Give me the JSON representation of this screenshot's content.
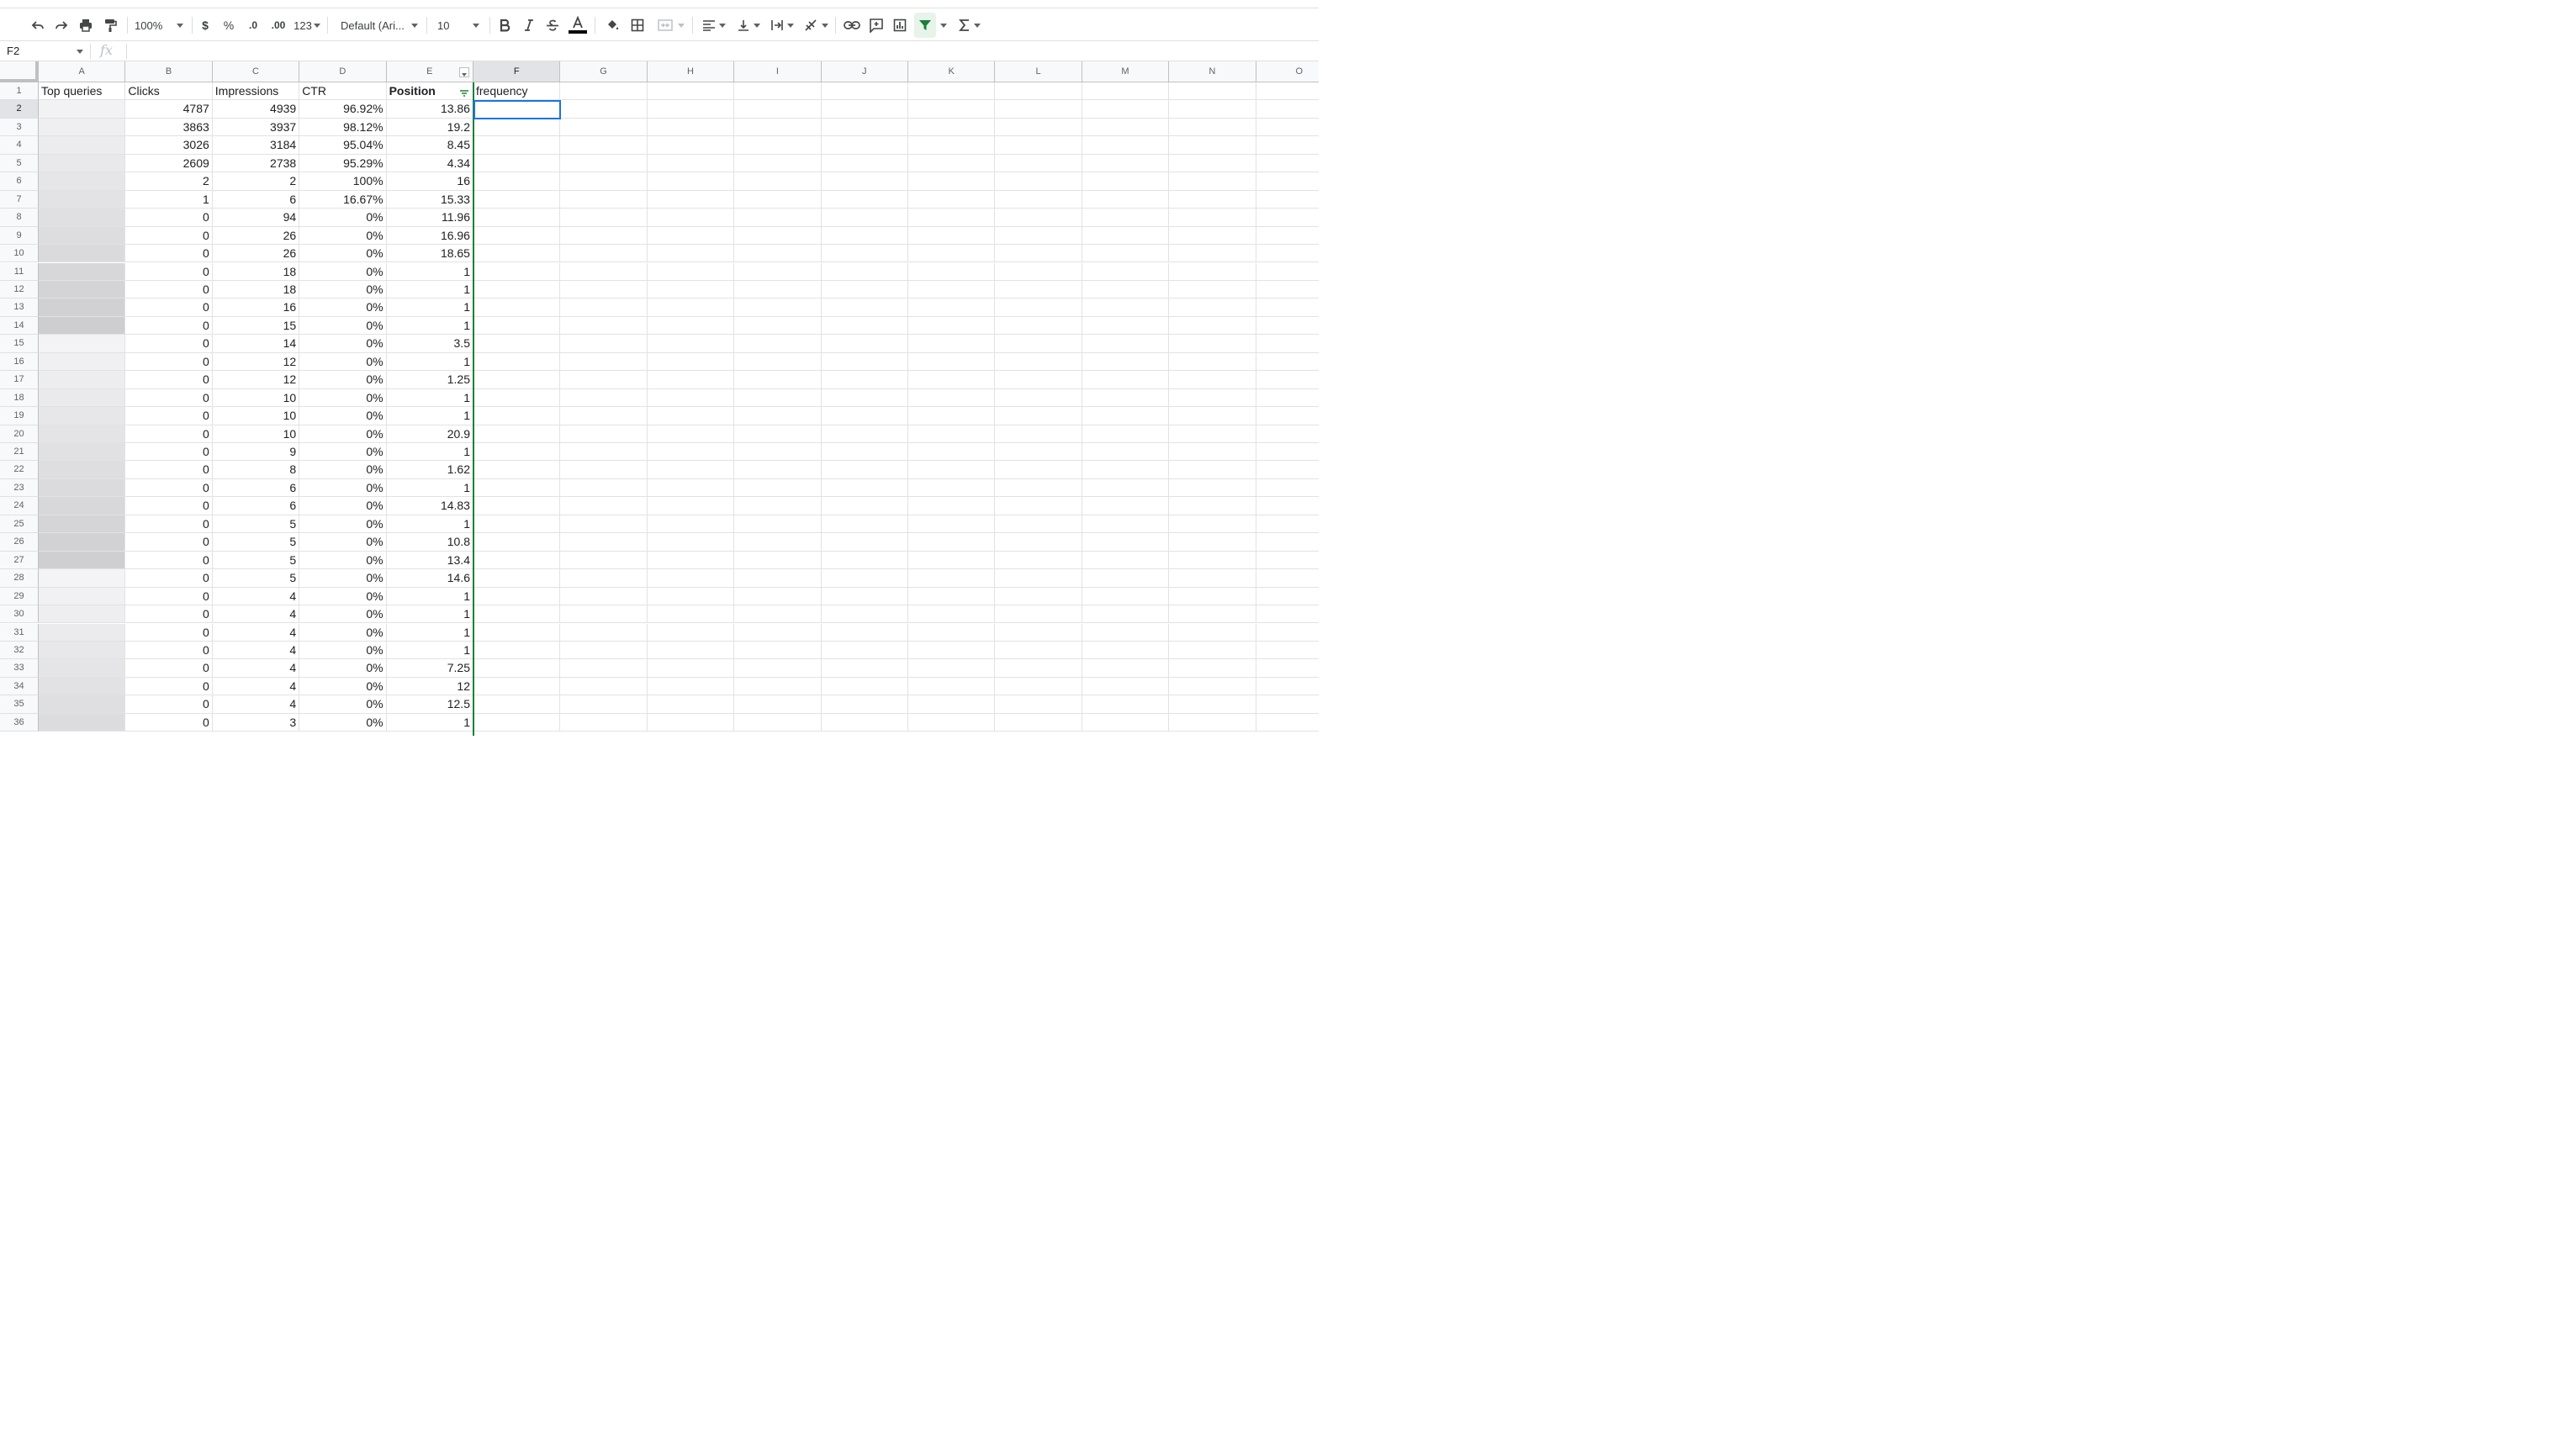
{
  "toolbar": {
    "zoom": "100%",
    "currency": "$",
    "percent": "%",
    "dec_less": ".0",
    "dec_more": ".00",
    "more_formats": "123",
    "font": "Default (Ari...",
    "font_size": "10",
    "icons": [
      "undo-icon",
      "redo-icon",
      "print-icon",
      "paint-format-icon",
      "bold-icon",
      "italic-icon",
      "strikethrough-icon",
      "text-color-icon",
      "fill-color-icon",
      "borders-icon",
      "merge-icon",
      "align-icon",
      "valign-icon",
      "wrap-icon",
      "rotate-icon",
      "link-icon",
      "comment-icon",
      "chart-icon",
      "filter-icon",
      "functions-icon"
    ],
    "accent_filter": "#188038"
  },
  "formula_bar": {
    "name_box": "F2",
    "fx": "fx",
    "content": ""
  },
  "columns": [
    "A",
    "B",
    "C",
    "D",
    "E",
    "F",
    "G",
    "H",
    "I",
    "J",
    "K",
    "L",
    "M",
    "N",
    "O"
  ],
  "selected_column": "F",
  "filtered_column": "E",
  "headers": {
    "a": "Top queries",
    "b": "Clicks",
    "c": "Impressions",
    "d": "CTR",
    "e": "Position",
    "f": "frequency"
  },
  "rows": [
    {
      "n": "1"
    },
    {
      "n": "2",
      "clicks": "4787",
      "impressions": "4939",
      "ctr": "96.92%",
      "position": "13.86"
    },
    {
      "n": "3",
      "clicks": "3863",
      "impressions": "3937",
      "ctr": "98.12%",
      "position": "19.2"
    },
    {
      "n": "4",
      "clicks": "3026",
      "impressions": "3184",
      "ctr": "95.04%",
      "position": "8.45"
    },
    {
      "n": "5",
      "clicks": "2609",
      "impressions": "2738",
      "ctr": "95.29%",
      "position": "4.34"
    },
    {
      "n": "6",
      "clicks": "2",
      "impressions": "2",
      "ctr": "100%",
      "position": "16"
    },
    {
      "n": "7",
      "clicks": "1",
      "impressions": "6",
      "ctr": "16.67%",
      "position": "15.33"
    },
    {
      "n": "8",
      "clicks": "0",
      "impressions": "94",
      "ctr": "0%",
      "position": "11.96"
    },
    {
      "n": "9",
      "clicks": "0",
      "impressions": "26",
      "ctr": "0%",
      "position": "16.96"
    },
    {
      "n": "10",
      "clicks": "0",
      "impressions": "26",
      "ctr": "0%",
      "position": "18.65"
    },
    {
      "n": "11",
      "clicks": "0",
      "impressions": "18",
      "ctr": "0%",
      "position": "1"
    },
    {
      "n": "12",
      "clicks": "0",
      "impressions": "18",
      "ctr": "0%",
      "position": "1"
    },
    {
      "n": "13",
      "clicks": "0",
      "impressions": "16",
      "ctr": "0%",
      "position": "1"
    },
    {
      "n": "14",
      "clicks": "0",
      "impressions": "15",
      "ctr": "0%",
      "position": "1"
    },
    {
      "n": "15",
      "clicks": "0",
      "impressions": "14",
      "ctr": "0%",
      "position": "3.5"
    },
    {
      "n": "16",
      "clicks": "0",
      "impressions": "12",
      "ctr": "0%",
      "position": "1"
    },
    {
      "n": "17",
      "clicks": "0",
      "impressions": "12",
      "ctr": "0%",
      "position": "1.25"
    },
    {
      "n": "18",
      "clicks": "0",
      "impressions": "10",
      "ctr": "0%",
      "position": "1"
    },
    {
      "n": "19",
      "clicks": "0",
      "impressions": "10",
      "ctr": "0%",
      "position": "1"
    },
    {
      "n": "20",
      "clicks": "0",
      "impressions": "10",
      "ctr": "0%",
      "position": "20.9"
    },
    {
      "n": "21",
      "clicks": "0",
      "impressions": "9",
      "ctr": "0%",
      "position": "1"
    },
    {
      "n": "22",
      "clicks": "0",
      "impressions": "8",
      "ctr": "0%",
      "position": "1.62"
    },
    {
      "n": "23",
      "clicks": "0",
      "impressions": "6",
      "ctr": "0%",
      "position": "1"
    },
    {
      "n": "24",
      "clicks": "0",
      "impressions": "6",
      "ctr": "0%",
      "position": "14.83"
    },
    {
      "n": "25",
      "clicks": "0",
      "impressions": "5",
      "ctr": "0%",
      "position": "1"
    },
    {
      "n": "26",
      "clicks": "0",
      "impressions": "5",
      "ctr": "0%",
      "position": "10.8"
    },
    {
      "n": "27",
      "clicks": "0",
      "impressions": "5",
      "ctr": "0%",
      "position": "13.4"
    },
    {
      "n": "28",
      "clicks": "0",
      "impressions": "5",
      "ctr": "0%",
      "position": "14.6"
    },
    {
      "n": "29",
      "clicks": "0",
      "impressions": "4",
      "ctr": "0%",
      "position": "1"
    },
    {
      "n": "30",
      "clicks": "0",
      "impressions": "4",
      "ctr": "0%",
      "position": "1"
    },
    {
      "n": "31",
      "clicks": "0",
      "impressions": "4",
      "ctr": "0%",
      "position": "1"
    },
    {
      "n": "32",
      "clicks": "0",
      "impressions": "4",
      "ctr": "0%",
      "position": "1"
    },
    {
      "n": "33",
      "clicks": "0",
      "impressions": "4",
      "ctr": "0%",
      "position": "7.25"
    },
    {
      "n": "34",
      "clicks": "0",
      "impressions": "4",
      "ctr": "0%",
      "position": "12"
    },
    {
      "n": "35",
      "clicks": "0",
      "impressions": "4",
      "ctr": "0%",
      "position": "12.5"
    },
    {
      "n": "36",
      "clicks": "0",
      "impressions": "3",
      "ctr": "0%",
      "position": "1"
    }
  ]
}
